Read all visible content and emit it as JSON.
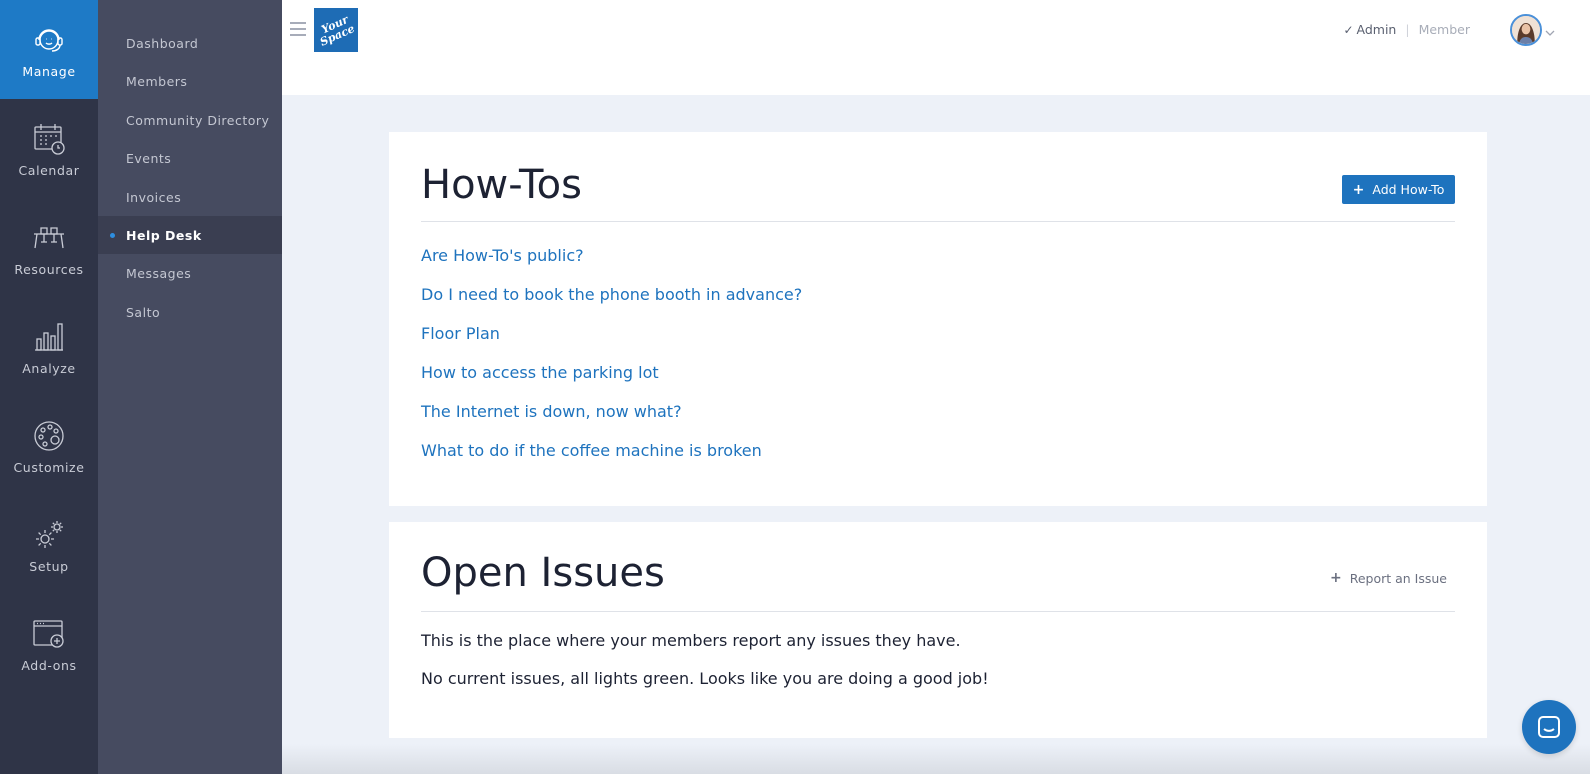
{
  "rail": {
    "items": [
      {
        "label": "Manage",
        "icon": "headset-icon",
        "active": true
      },
      {
        "label": "Calendar",
        "icon": "calendar-icon",
        "active": false
      },
      {
        "label": "Resources",
        "icon": "desk-chairs-icon",
        "active": false
      },
      {
        "label": "Analyze",
        "icon": "bar-chart-icon",
        "active": false
      },
      {
        "label": "Customize",
        "icon": "palette-icon",
        "active": false
      },
      {
        "label": "Setup",
        "icon": "gears-icon",
        "active": false
      },
      {
        "label": "Add-ons",
        "icon": "window-plus-icon",
        "active": false
      }
    ]
  },
  "subnav": {
    "items": [
      {
        "label": "Dashboard",
        "active": false
      },
      {
        "label": "Members",
        "active": false
      },
      {
        "label": "Community Directory",
        "active": false
      },
      {
        "label": "Events",
        "active": false
      },
      {
        "label": "Invoices",
        "active": false
      },
      {
        "label": "Help Desk",
        "active": true
      },
      {
        "label": "Messages",
        "active": false
      },
      {
        "label": "Salto",
        "active": false
      }
    ]
  },
  "header": {
    "logo_line1": "Your",
    "logo_line2": "Space",
    "role_admin": "Admin",
    "role_separator": "|",
    "role_member": "Member"
  },
  "howtos": {
    "title": "How-Tos",
    "add_label": "Add How-To",
    "links": [
      "Are How-To's public?",
      "Do I need to book the phone booth in advance?",
      "Floor Plan",
      "How to access the parking lot",
      "The Internet is down, now what?",
      "What to do if the coffee machine is broken"
    ]
  },
  "issues": {
    "title": "Open Issues",
    "report_label": "Report an Issue",
    "description": "This is the place where your members report any issues they have.",
    "status": "No current issues, all lights green. Looks like you are doing a good job!"
  },
  "colors": {
    "accent": "#1e73be",
    "rail_bg": "#2f3447",
    "subnav_bg": "#464b60",
    "page_bg": "#edf1f8"
  }
}
